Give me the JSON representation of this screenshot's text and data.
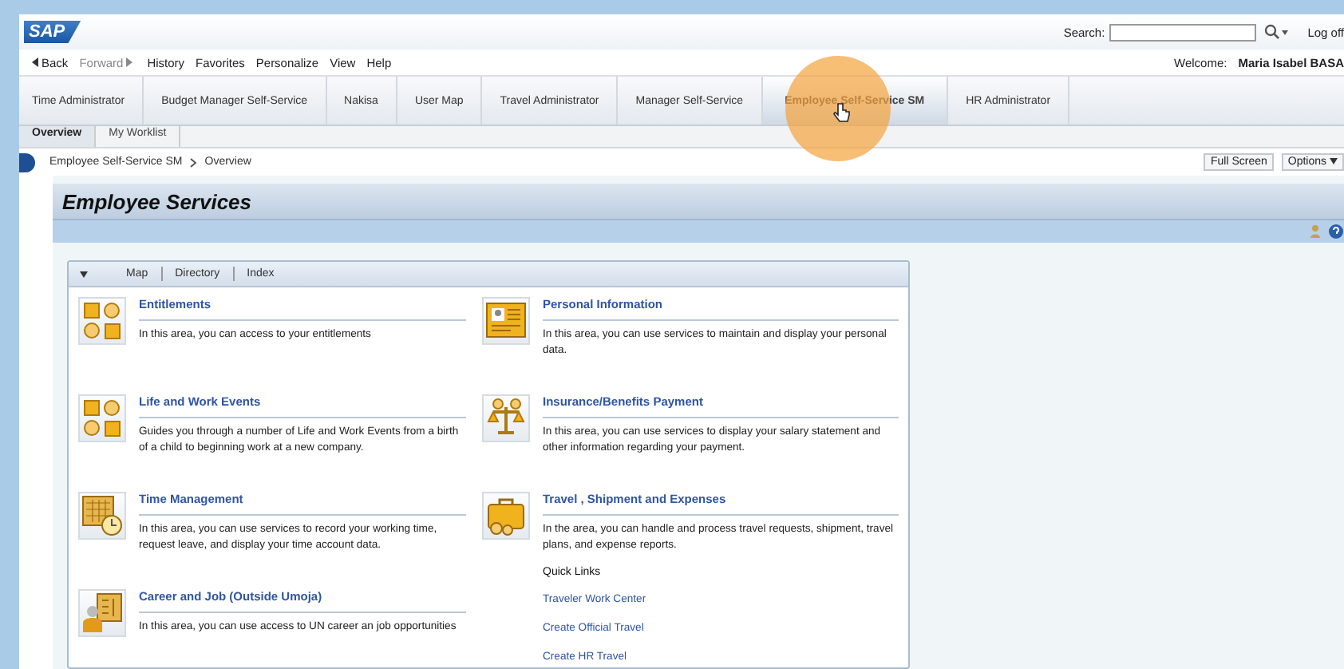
{
  "header": {
    "logo": "SAP",
    "search_label": "Search:",
    "logoff": "Log off"
  },
  "nav": {
    "back": "Back",
    "forward": "Forward",
    "links": [
      "History",
      "Favorites",
      "Personalize",
      "View",
      "Help"
    ],
    "welcome_label": "Welcome:",
    "user": "Maria Isabel BASA"
  },
  "tabs": [
    {
      "label": "Time Administrator",
      "selected": false
    },
    {
      "label": "Budget Manager Self-Service",
      "selected": false
    },
    {
      "label": "Nakisa",
      "selected": false
    },
    {
      "label": "User Map",
      "selected": false
    },
    {
      "label": "Travel Administrator",
      "selected": false
    },
    {
      "label": "Manager Self-Service",
      "selected": false
    },
    {
      "label": "Employee Self-Service SM",
      "selected": true
    },
    {
      "label": "HR Administrator",
      "selected": false
    }
  ],
  "subtabs": [
    {
      "label": "Overview",
      "selected": true
    },
    {
      "label": "My Worklist",
      "selected": false
    }
  ],
  "breadcrumb": [
    "Employee Self-Service SM",
    "Overview"
  ],
  "page_buttons": [
    "Full Screen",
    "Options"
  ],
  "page_title": "Employee Services",
  "view_tabs": [
    "Map",
    "Directory",
    "Index"
  ],
  "columns": [
    [
      {
        "title": "Entitlements",
        "text": "In this area, you can access to your entitlements"
      },
      {
        "title": "Life and Work Events",
        "text": "Guides you through a number of Life and Work Events from a birth of a child to beginning work at a new company."
      },
      {
        "title": "Time Management",
        "text": "In this area, you can use services to record your working time, request leave, and display your time account data."
      },
      {
        "title": "Career and Job (Outside Umoja)",
        "text": "In this area, you can use access to UN career an job opportunities"
      }
    ],
    [
      {
        "title": "Personal Information",
        "text": "In this area, you can use services to maintain and display your personal data."
      },
      {
        "title": "Insurance/Benefits Payment",
        "text": "In this area, you can use services to display your salary statement and other information regarding your payment."
      },
      {
        "title": "Travel , Shipment and Expenses",
        "text": "In the area, you can handle and process travel requests, shipment, travel plans, and expense reports.",
        "quick_links_label": "Quick Links",
        "quick_links": [
          "Traveler Work Center",
          "Create Official Travel",
          "Create HR Travel"
        ]
      }
    ]
  ]
}
